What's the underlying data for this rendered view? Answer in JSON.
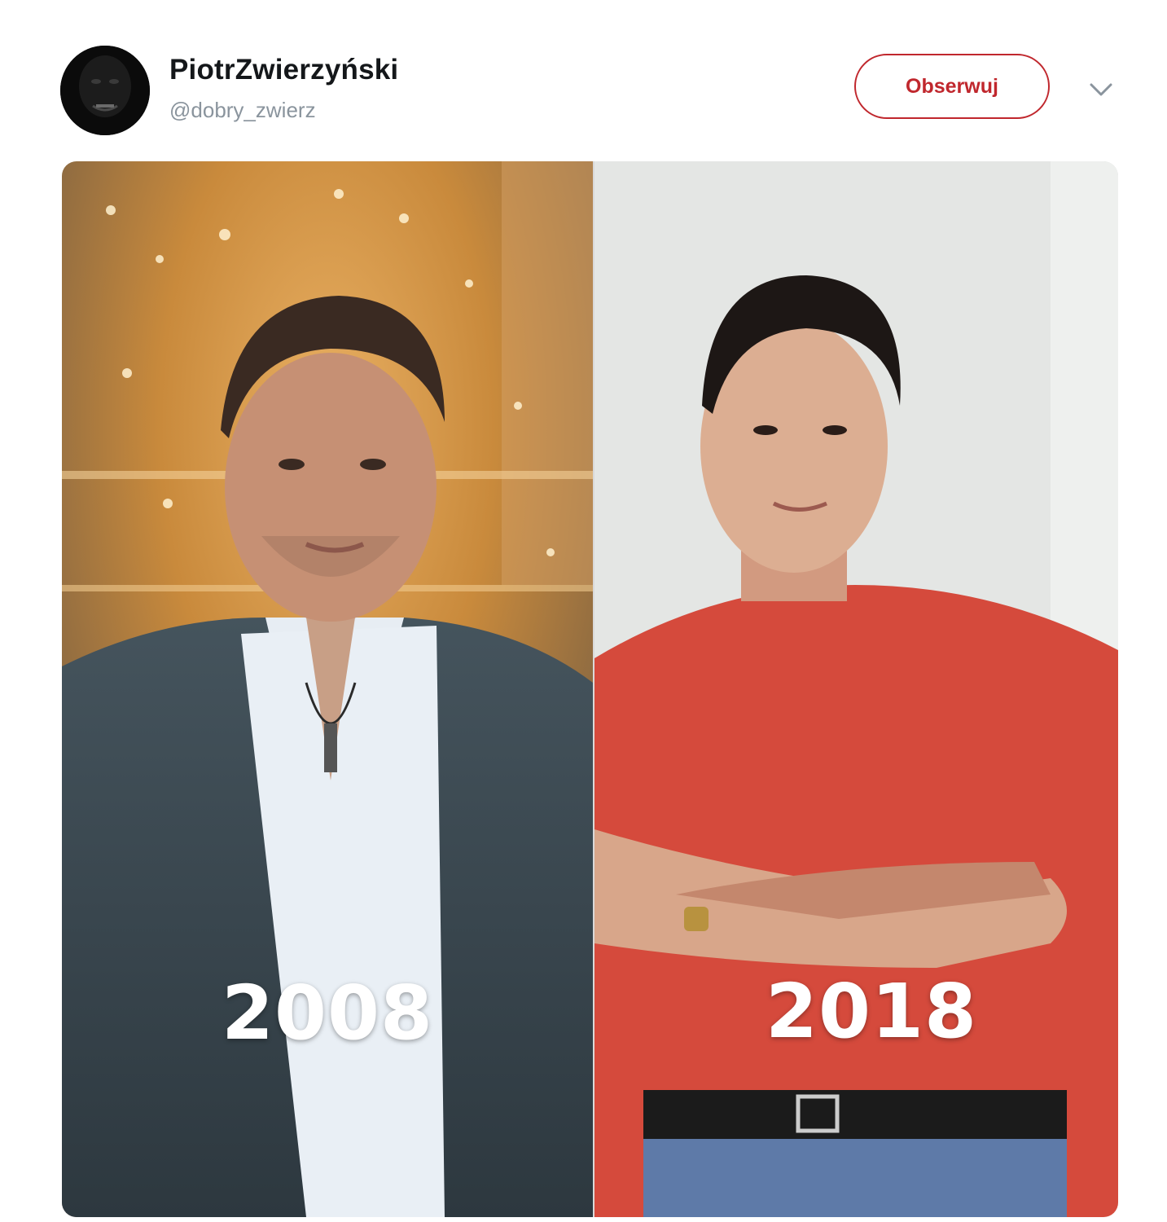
{
  "tweet": {
    "author": {
      "display_name": "PiotrZwierzyński",
      "handle": "@dobry_zwierz"
    },
    "follow_button_label": "Obserwuj",
    "media": {
      "left_label": "2008",
      "right_label": "2018"
    }
  },
  "colors": {
    "follow_accent": "#c0272d",
    "name_text": "#14171a",
    "handle_text": "#8a949d"
  },
  "icons": {
    "more_menu": "chevron-down-icon"
  }
}
